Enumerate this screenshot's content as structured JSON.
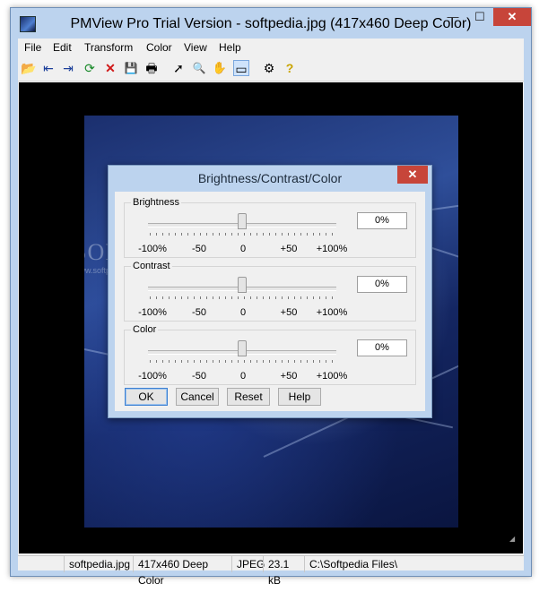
{
  "window": {
    "title": "PMView Pro Trial Version - softpedia.jpg (417x460 Deep Color)",
    "min_glyph": "—",
    "max_glyph": "☐",
    "close_glyph": "✕"
  },
  "menu": [
    "File",
    "Edit",
    "Transform",
    "Color",
    "View",
    "Help"
  ],
  "toolbar": {
    "icons": [
      "open-folder-icon",
      "previous-image-icon",
      "next-image-icon",
      "refresh-icon",
      "delete-icon",
      "save-icon",
      "print-icon",
      "pointer-icon",
      "zoom-icon",
      "pan-hand-icon",
      "select-rectangle-icon",
      "properties-icon",
      "help-icon"
    ],
    "glyphs": [
      "📂",
      "⇤",
      "⇥",
      "⟳",
      "✕",
      "💾",
      "🖶",
      "➚",
      "🔍",
      "✋",
      "▭",
      "⚙",
      "?"
    ]
  },
  "image": {
    "watermark": "SOFTPEDIA",
    "watermark_sub": "www.softpedia.com"
  },
  "dialog": {
    "title": "Brightness/Contrast/Color",
    "close_glyph": "✕",
    "groups": [
      {
        "label": "Brightness",
        "value": "0%",
        "level": 0
      },
      {
        "label": "Contrast",
        "value": "0%",
        "level": 0
      },
      {
        "label": "Color",
        "value": "0%",
        "level": 0
      }
    ],
    "tick_labels": [
      "-100%",
      "-50",
      "0",
      "+50",
      "+100%"
    ],
    "buttons": {
      "ok": "OK",
      "cancel": "Cancel",
      "reset": "Reset",
      "help": "Help"
    }
  },
  "status": {
    "filename": "softpedia.jpg",
    "dimensions": "417x460 Deep Color",
    "format": "JPEG",
    "size": "23.1 kB",
    "path": "C:\\Softpedia Files\\"
  },
  "colors": {
    "frame": "#bcd3ee",
    "close_button": "#c7453a",
    "viewport": "#000000"
  }
}
